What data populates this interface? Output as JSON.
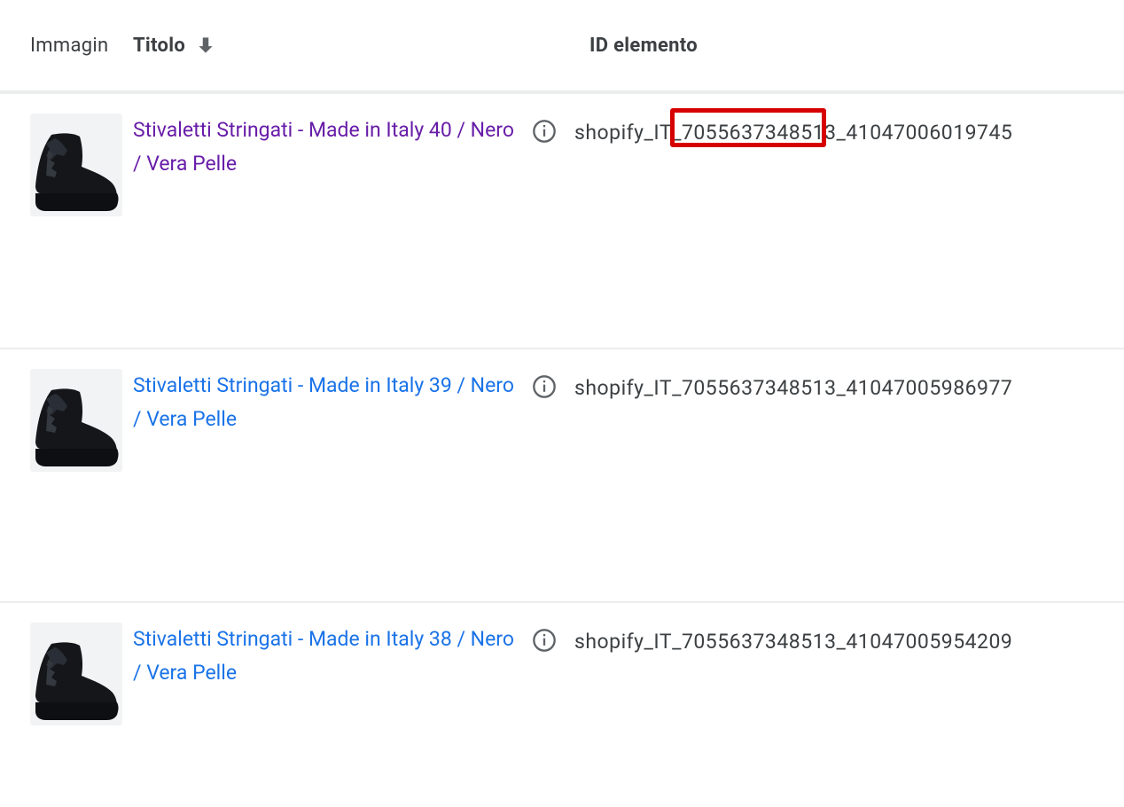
{
  "header": {
    "image": "Immagin",
    "title": "Titolo",
    "id": "ID elemento"
  },
  "highlighted_id_fragment": "7055637348513",
  "rows": [
    {
      "title": "Stivaletti Stringati - Made in Italy 40 / Nero / Vera Pelle",
      "id": "shopify_IT_7055637348513_41047006019745",
      "visited": true,
      "highlight": true
    },
    {
      "title": "Stivaletti Stringati - Made in Italy 39 / Nero / Vera Pelle",
      "id": "shopify_IT_7055637348513_41047005986977",
      "visited": false,
      "highlight": false
    },
    {
      "title": "Stivaletti Stringati - Made in Italy 38 / Nero / Vera Pelle",
      "id": "shopify_IT_7055637348513_41047005954209",
      "visited": false,
      "highlight": false
    }
  ]
}
